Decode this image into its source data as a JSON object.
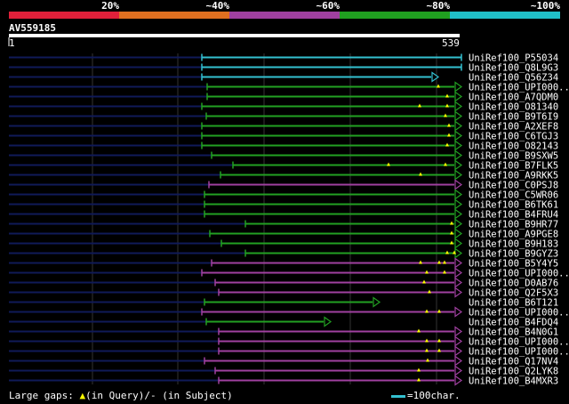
{
  "legend": {
    "colors": [
      "#e0203a",
      "#e07020",
      "#a040a0",
      "#20a020",
      "#20c0c8"
    ],
    "labels": [
      "20%",
      "~40%",
      "~60%",
      "~80%",
      "~100%"
    ]
  },
  "query": {
    "name": "AV559185",
    "start": "1",
    "end": "539"
  },
  "hits": [
    {
      "label": "UniRef100_P55034",
      "color": "cyan",
      "start": 227,
      "end": 519,
      "arrow": false,
      "marks": []
    },
    {
      "label": "UniRef100_Q8L9G3",
      "color": "cyan",
      "start": 227,
      "end": 519,
      "arrow": false,
      "marks": []
    },
    {
      "label": "UniRef100_Q56Z34",
      "color": "cyan",
      "start": 227,
      "end": 486,
      "arrow": true,
      "marks": []
    },
    {
      "label": "UniRef100_UPI000..",
      "color": "green",
      "start": 233,
      "end": 512,
      "arrow": true,
      "marks": [
        493
      ]
    },
    {
      "label": "UniRef100_A7QDM0",
      "color": "green",
      "start": 233,
      "end": 512,
      "arrow": true,
      "marks": [
        503
      ]
    },
    {
      "label": "UniRef100_O81340",
      "color": "green",
      "start": 227,
      "end": 512,
      "arrow": true,
      "marks": [
        472,
        503
      ]
    },
    {
      "label": "UniRef100_B9T6I9",
      "color": "green",
      "start": 232,
      "end": 512,
      "arrow": true,
      "marks": [
        501
      ]
    },
    {
      "label": "UniRef100_A2XEF8",
      "color": "green",
      "start": 227,
      "end": 512,
      "arrow": true,
      "marks": [
        505
      ]
    },
    {
      "label": "UniRef100_C6TGJ3",
      "color": "green",
      "start": 227,
      "end": 512,
      "arrow": true,
      "marks": [
        505
      ]
    },
    {
      "label": "UniRef100_O82143",
      "color": "green",
      "start": 227,
      "end": 512,
      "arrow": true,
      "marks": [
        503
      ]
    },
    {
      "label": "UniRef100_B9SXW5",
      "color": "green",
      "start": 238,
      "end": 512,
      "arrow": true,
      "marks": []
    },
    {
      "label": "UniRef100_B7FLK5",
      "color": "green",
      "start": 262,
      "end": 512,
      "arrow": true,
      "marks": [
        437,
        501
      ]
    },
    {
      "label": "UniRef100_A9RKK5",
      "color": "green",
      "start": 248,
      "end": 512,
      "arrow": true,
      "marks": [
        473
      ]
    },
    {
      "label": "UniRef100_C0PSJ8",
      "color": "purple",
      "start": 235,
      "end": 512,
      "arrow": true,
      "marks": []
    },
    {
      "label": "UniRef100_C5WR06",
      "color": "green",
      "start": 230,
      "end": 512,
      "arrow": true,
      "marks": []
    },
    {
      "label": "UniRef100_B6TK61",
      "color": "green",
      "start": 230,
      "end": 512,
      "arrow": true,
      "marks": []
    },
    {
      "label": "UniRef100_B4FRU4",
      "color": "green",
      "start": 230,
      "end": 512,
      "arrow": true,
      "marks": []
    },
    {
      "label": "UniRef100_B9HR77",
      "color": "green",
      "start": 276,
      "end": 512,
      "arrow": true,
      "marks": [
        508
      ]
    },
    {
      "label": "UniRef100_A9PGE8",
      "color": "green",
      "start": 236,
      "end": 512,
      "arrow": true,
      "marks": [
        508
      ]
    },
    {
      "label": "UniRef100_B9H183",
      "color": "green",
      "start": 249,
      "end": 512,
      "arrow": true,
      "marks": [
        508
      ]
    },
    {
      "label": "UniRef100_B9GYZ3",
      "color": "green",
      "start": 276,
      "end": 512,
      "arrow": true,
      "marks": [
        503,
        511
      ]
    },
    {
      "label": "UniRef100_B5Y4Y5",
      "color": "purple",
      "start": 238,
      "end": 512,
      "arrow": true,
      "marks": [
        473,
        494,
        500
      ]
    },
    {
      "label": "UniRef100_UPI000..",
      "color": "purple",
      "start": 227,
      "end": 512,
      "arrow": true,
      "marks": [
        480,
        500
      ]
    },
    {
      "label": "UniRef100_D0AB76",
      "color": "purple",
      "start": 242,
      "end": 512,
      "arrow": true,
      "marks": [
        477
      ]
    },
    {
      "label": "UniRef100_Q2F5X3",
      "color": "purple",
      "start": 246,
      "end": 512,
      "arrow": true,
      "marks": [
        483
      ]
    },
    {
      "label": "UniRef100_B6T121",
      "color": "green",
      "start": 230,
      "end": 420,
      "arrow": true,
      "marks": []
    },
    {
      "label": "UniRef100_UPI000..",
      "color": "purple",
      "start": 227,
      "end": 512,
      "arrow": true,
      "marks": [
        480,
        494
      ]
    },
    {
      "label": "UniRef100_B4FDQ4",
      "color": "green",
      "start": 232,
      "end": 365,
      "arrow": true,
      "marks": []
    },
    {
      "label": "UniRef100_B4N0G1",
      "color": "purple",
      "start": 246,
      "end": 512,
      "arrow": true,
      "marks": [
        471
      ]
    },
    {
      "label": "UniRef100_UPI000..",
      "color": "purple",
      "start": 246,
      "end": 512,
      "arrow": true,
      "marks": [
        480,
        494
      ]
    },
    {
      "label": "UniRef100_UPI000..",
      "color": "purple",
      "start": 246,
      "end": 512,
      "arrow": true,
      "marks": [
        480,
        494
      ]
    },
    {
      "label": "UniRef100_Q17NV4",
      "color": "purple",
      "start": 230,
      "end": 512,
      "arrow": true,
      "marks": [
        481
      ]
    },
    {
      "label": "UniRef100_Q2LYK8",
      "color": "purple",
      "start": 242,
      "end": 512,
      "arrow": true,
      "marks": [
        471
      ]
    },
    {
      "label": "UniRef100_B4MXR3",
      "color": "purple",
      "start": 246,
      "end": 512,
      "arrow": true,
      "marks": [
        471
      ]
    }
  ],
  "footer": {
    "prefix": "Large gaps:",
    "tri": "▲",
    "query_note": "(in Query)/",
    "dash": "-",
    "subject_note": " (in Subject)",
    "scale_label": "=100char."
  }
}
